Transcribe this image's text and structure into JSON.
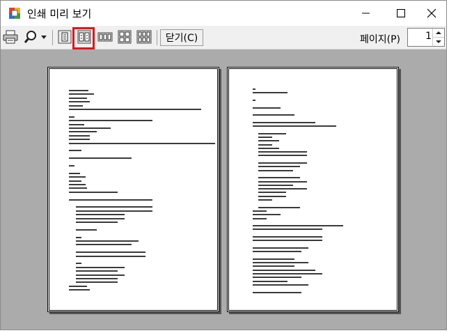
{
  "window": {
    "title": "인쇄 미리 보기",
    "icon": "print-preview-app-icon"
  },
  "titlebar_controls": {
    "minimize_icon": "minimize-icon",
    "maximize_icon": "maximize-icon",
    "close_icon": "close-icon"
  },
  "toolbar": {
    "tools": [
      {
        "name": "print-button",
        "icon": "printer-icon"
      },
      {
        "name": "zoom-button",
        "icon": "magnifier-icon"
      },
      {
        "name": "one-page-button",
        "icon": "one-page-icon"
      },
      {
        "name": "two-pages-button",
        "icon": "two-pages-icon",
        "selected": true
      },
      {
        "name": "three-pages-button",
        "icon": "three-pages-icon"
      },
      {
        "name": "four-pages-button",
        "icon": "four-pages-icon"
      },
      {
        "name": "six-pages-button",
        "icon": "six-pages-icon"
      }
    ],
    "close_label": "닫기(C)",
    "page_label": "페이지(P)",
    "page_value": "1"
  },
  "colors": {
    "highlight": "#e3141b",
    "preview_background": "#ababab",
    "toolbar_background": "#f0f0f0"
  }
}
